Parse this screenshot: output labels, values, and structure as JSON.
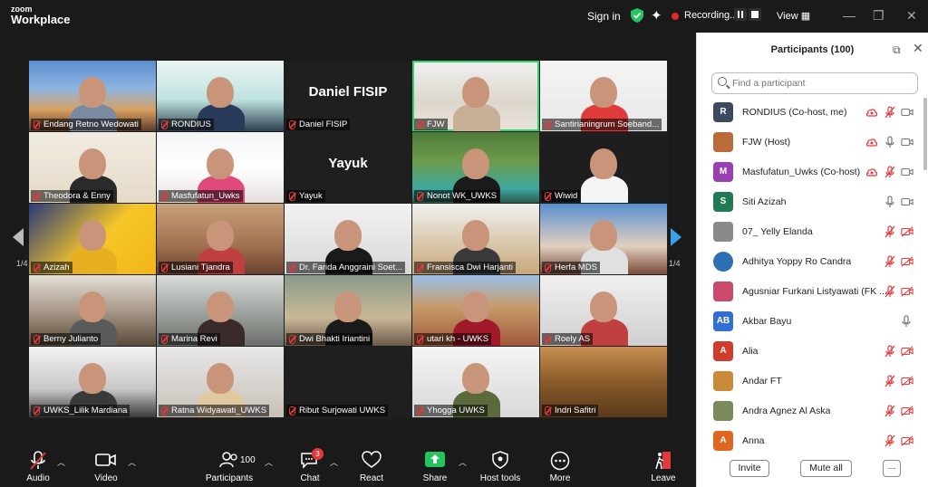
{
  "app": {
    "brand_line1": "zoom",
    "brand_line2": "Workplace"
  },
  "topbar": {
    "sign_in": "Sign in",
    "recording": "Recording...",
    "view": "View"
  },
  "gallery": {
    "page_label_left": "1/4",
    "page_label_right": "1/4",
    "tiles": [
      {
        "name": "Endang Retno Wedowati",
        "big": ""
      },
      {
        "name": "RONDIUS",
        "big": ""
      },
      {
        "name": "Daniel FISIP",
        "big": "Daniel FISIP"
      },
      {
        "name": "FJW",
        "big": ""
      },
      {
        "name": "Santirianingrum Soeband...",
        "big": ""
      },
      {
        "name": "Theodora & Enny",
        "big": ""
      },
      {
        "name": "Masfufatun_Uwks",
        "big": ""
      },
      {
        "name": "Yayuk",
        "big": "Yayuk"
      },
      {
        "name": "Nonot WK_UWKS",
        "big": ""
      },
      {
        "name": "Wiwid",
        "big": ""
      },
      {
        "name": "Azizah",
        "big": ""
      },
      {
        "name": "Lusiani Tjandra",
        "big": ""
      },
      {
        "name": "Dr. Farida Anggraini Soet...",
        "big": ""
      },
      {
        "name": "Fransisca Dwi Harjanti",
        "big": ""
      },
      {
        "name": "Herfa MDS",
        "big": ""
      },
      {
        "name": "Berny Julianto",
        "big": ""
      },
      {
        "name": "Marina Revi",
        "big": ""
      },
      {
        "name": "Dwi Bhakti Iriantini",
        "big": ""
      },
      {
        "name": "utari kh - UWKS",
        "big": ""
      },
      {
        "name": "Roely AS",
        "big": ""
      },
      {
        "name": "UWKS_Lilik Mardiana",
        "big": ""
      },
      {
        "name": "Ratna Widyawati_UWKS",
        "big": ""
      },
      {
        "name": "Ribut Surjowati UWKS",
        "big": ""
      },
      {
        "name": "Yhogga UWKS",
        "big": ""
      },
      {
        "name": "Indri Safitri",
        "big": ""
      }
    ]
  },
  "toolbar": {
    "audio": "Audio",
    "video": "Video",
    "participants": "Participants",
    "participants_count": "100",
    "chat": "Chat",
    "chat_badge": "3",
    "react": "React",
    "share": "Share",
    "host_tools": "Host tools",
    "more": "More",
    "leave": "Leave"
  },
  "panel": {
    "title": "Participants (100)",
    "search_placeholder": "Find a participant",
    "participants": [
      {
        "initial": "R",
        "name": "RONDIUS (Co-host, me)",
        "color": "#3b4a5e"
      },
      {
        "initial": "",
        "name": "FJW (Host)",
        "color": "#b96b3a"
      },
      {
        "initial": "M",
        "name": "Masfufatun_Uwks (Co-host)",
        "color": "#9b3fb5"
      },
      {
        "initial": "S",
        "name": "Siti Azizah",
        "color": "#1f7a55"
      },
      {
        "initial": "",
        "name": "07_ Yelly Elanda",
        "color": "#8a8a8a"
      },
      {
        "initial": "",
        "name": "Adhitya Yoppy Ro Candra",
        "color": "#2d6fb3"
      },
      {
        "initial": "",
        "name": "Agusniar Furkani Listyawati (FK ...",
        "color": "#c94a6a"
      },
      {
        "initial": "AB",
        "name": "Akbar Bayu",
        "color": "#2f6fd6"
      },
      {
        "initial": "A",
        "name": "Alia",
        "color": "#d23c2c"
      },
      {
        "initial": "",
        "name": "Andar FT",
        "color": "#c98a3a"
      },
      {
        "initial": "",
        "name": "Andra Agnez Al Aska",
        "color": "#7a8a5a"
      },
      {
        "initial": "A",
        "name": "Anna",
        "color": "#e0651f"
      }
    ],
    "invite": "Invite",
    "mute_all": "Mute all",
    "more": "..."
  },
  "colors": {
    "accent_green": "#2dd36f",
    "mute_red": "#e23a3a",
    "share_green": "#23c55e",
    "nav_blue": "#3aa0e8"
  }
}
